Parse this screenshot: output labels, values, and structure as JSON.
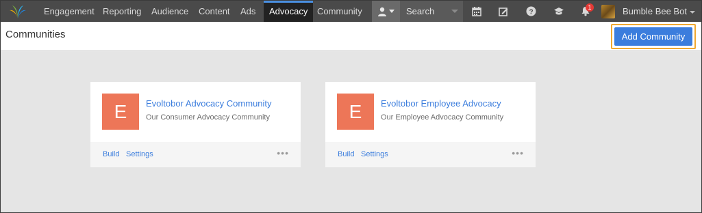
{
  "nav": {
    "items": [
      {
        "label": "Engagement",
        "active": false
      },
      {
        "label": "Reporting",
        "active": false
      },
      {
        "label": "Audience",
        "active": false
      },
      {
        "label": "Content",
        "active": false
      },
      {
        "label": "Ads",
        "active": false
      },
      {
        "label": "Advocacy",
        "active": true
      },
      {
        "label": "Community",
        "active": false
      }
    ],
    "search_placeholder": "Search",
    "notification_count": "1",
    "user_name": "Bumble Bee Bot",
    "icons": [
      "logo-icon",
      "user-icon",
      "calendar-icon",
      "compose-icon",
      "help-icon",
      "learning-icon",
      "bell-icon"
    ]
  },
  "header": {
    "title": "Communities",
    "add_button_label": "Add Community"
  },
  "communities": [
    {
      "initial": "E",
      "name": "Evoltobor Advocacy Community",
      "description": "Our Consumer Advocacy Community",
      "build_label": "Build",
      "settings_label": "Settings",
      "more_label": "•••"
    },
    {
      "initial": "E",
      "name": "Evoltobor Employee Advocacy",
      "description": "Our Employee Advocacy Community",
      "build_label": "Build",
      "settings_label": "Settings",
      "more_label": "•••"
    }
  ],
  "colors": {
    "nav_bg": "#4a4a4a",
    "accent": "#3b7ddd",
    "logo_tile": "#ed7658",
    "highlight": "#f0a830",
    "content_bg": "#e5e5e5"
  }
}
